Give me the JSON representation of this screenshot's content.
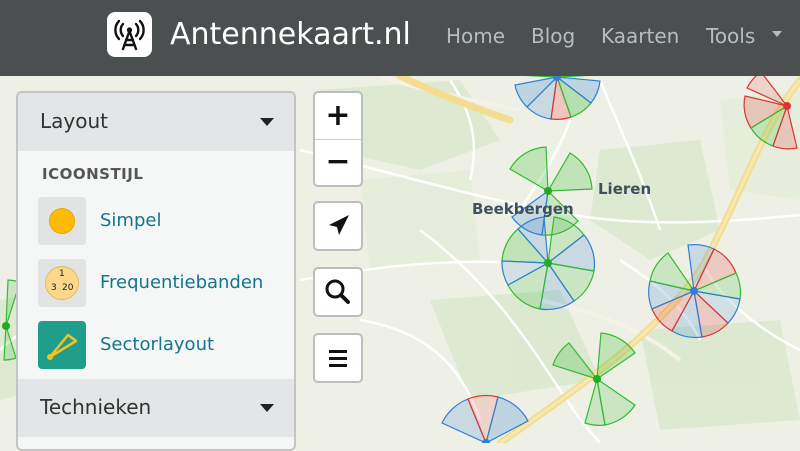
{
  "navbar": {
    "brand_title": "Antennekaart.nl",
    "brand_icon": "antenna-icon",
    "links": [
      "Home",
      "Blog",
      "Kaarten",
      "Tools"
    ]
  },
  "panel": {
    "layout_header": "Layout",
    "section_title": "ICOONSTIJL",
    "options": [
      {
        "label": "Simpel",
        "icon": "simple-dot-icon"
      },
      {
        "label": "Frequentiebanden",
        "icon": "frequency-bands-icon",
        "icon_text": [
          "1",
          "3",
          "20"
        ]
      },
      {
        "label": "Sectorlayout",
        "icon": "sector-layout-icon"
      }
    ],
    "techniques_header": "Technieken"
  },
  "map": {
    "places": [
      "Lieren",
      "Beekbergen"
    ]
  },
  "controls": {
    "zoom_in": "+",
    "zoom_out": "−"
  },
  "colors": {
    "navbar_bg": "#4b4f50",
    "link_color": "#14748f",
    "sector_green": "#33bb33",
    "sector_blue": "#3388dd",
    "sector_red": "#dd3333",
    "road_yellow": "#f6e08f"
  }
}
